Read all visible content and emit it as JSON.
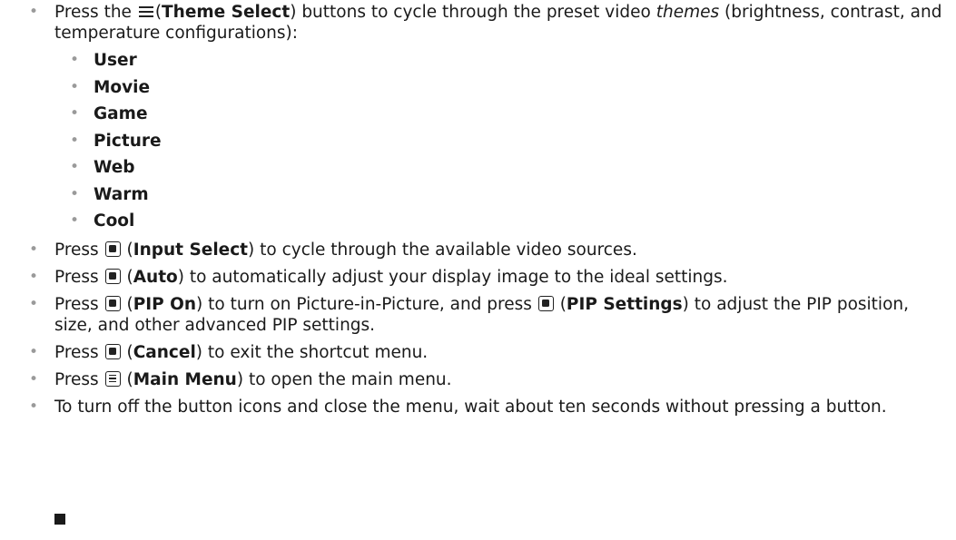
{
  "bullet_glyph": "•",
  "item1": {
    "press": "Press the",
    "paren_open": "(",
    "bold": "Theme Select",
    "rest1": ") buttons to cycle through the preset video",
    "italic": "themes",
    "rest2": "(brightness, contrast, and temperature configurations):",
    "themes": [
      "User",
      "Movie",
      "Game",
      "Picture",
      "Web",
      "Warm",
      "Cool"
    ]
  },
  "item2": {
    "press": "Press",
    "paren_open": "(",
    "bold": "Input Select",
    "rest": ") to cycle through the available video sources."
  },
  "item3": {
    "press": "Press",
    "paren_open": "(",
    "bold": "Auto",
    "rest": ") to automatically adjust your display image to the ideal settings."
  },
  "item4": {
    "press": "Press",
    "paren_open": "(",
    "bold1": "PIP On",
    "mid": ") to turn on Picture-in-Picture, and press",
    "paren_open2": "(",
    "bold2": "PIP Settings",
    "rest": ") to adjust the PIP position, size, and other advanced PIP settings."
  },
  "item5": {
    "press": "Press",
    "paren_open": "(",
    "bold": "Cancel",
    "rest": ") to exit the shortcut menu."
  },
  "item6": {
    "press": "Press",
    "paren_open": "(",
    "bold": "Main Menu",
    "rest": ") to open the main menu."
  },
  "item7": {
    "text": "To turn off the button icons and close the menu, wait about ten seconds without pressing a button."
  },
  "icons": {
    "theme_select": "theme-select-icon",
    "square_button": "square-button-icon",
    "main_menu": "main-menu-icon",
    "end_mark": "end-of-section-mark"
  }
}
